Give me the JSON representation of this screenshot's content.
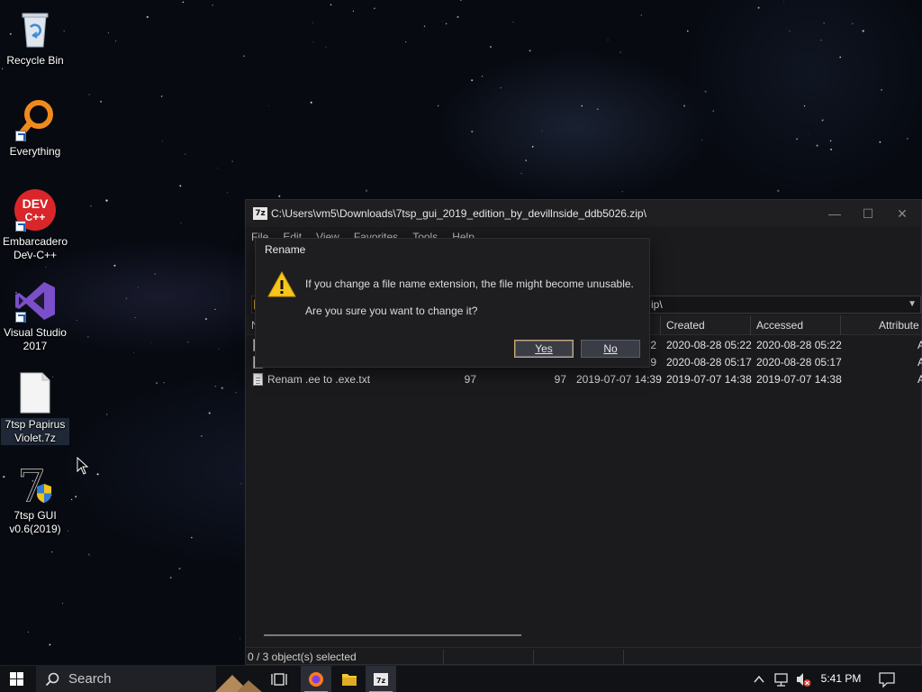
{
  "desktop": {
    "icons": [
      {
        "label": "Recycle Bin",
        "icon": "recycle-bin-icon"
      },
      {
        "label": "Everything",
        "icon": "everything-search-icon"
      },
      {
        "label": "Embarcadero Dev-C++",
        "icon": "dev-cpp-icon",
        "badge": "DEV C++"
      },
      {
        "label": "Visual Studio 2017",
        "icon": "visual-studio-icon"
      },
      {
        "label": "7tsp Papirus Violet.7z",
        "icon": "7z-file-icon"
      },
      {
        "label": "7tsp GUI v0.6(2019)",
        "icon": "7tsp-gui-icon",
        "badge": "7"
      }
    ]
  },
  "zip_window": {
    "title": "C:\\Users\\vm5\\Downloads\\7tsp_gui_2019_edition_by_devillnside_ddb5026.zip\\",
    "app_icon_text": "7z",
    "menu": [
      "File",
      "Edit",
      "View",
      "Favorites",
      "Tools",
      "Help"
    ],
    "address": "C:\\Users\\vm5\\Downloads\\7tsp_gui_2019_edition_by_devillnside_ddb5026.zip\\",
    "address_visible_tail": "ip\\",
    "columns": {
      "name": "N",
      "created": "Created",
      "accessed": "Accessed",
      "attributes": "Attribute"
    },
    "rows": [
      {
        "name": "",
        "size": "",
        "packed": "2",
        "modified": "",
        "created": "2020-08-28 05:22",
        "accessed": "2020-08-28 05:22",
        "attr": "A"
      },
      {
        "name": "",
        "size": "",
        "packed": "9",
        "modified": "",
        "created": "2020-08-28 05:17",
        "accessed": "2020-08-28 05:17",
        "attr": "A"
      },
      {
        "name": "Renam .ee to .exe.txt",
        "size": "97",
        "packed": "97",
        "modified": "2019-07-07 14:39",
        "created": "2019-07-07 14:38",
        "accessed": "2019-07-07 14:38",
        "attr": "A"
      }
    ],
    "status": "0 / 3 object(s) selected",
    "controls": {
      "minimize": "—",
      "maximize": "☐",
      "close": "✕"
    }
  },
  "rename_dialog": {
    "title": "Rename",
    "message1": "If you change a file name extension, the file might become unusable.",
    "message2": "Are you sure you want to change it?",
    "yes_label": "Yes",
    "no_label": "No"
  },
  "taskbar": {
    "search_placeholder": "Search",
    "clock": "5:41 PM",
    "pinned": [
      "task-view-icon",
      "firefox-icon",
      "file-explorer-icon",
      "7zip-icon"
    ]
  },
  "colors": {
    "accent": "#c9a86a",
    "window_bg": "#1b1b1e",
    "dialog_bg": "#1e1e21"
  }
}
